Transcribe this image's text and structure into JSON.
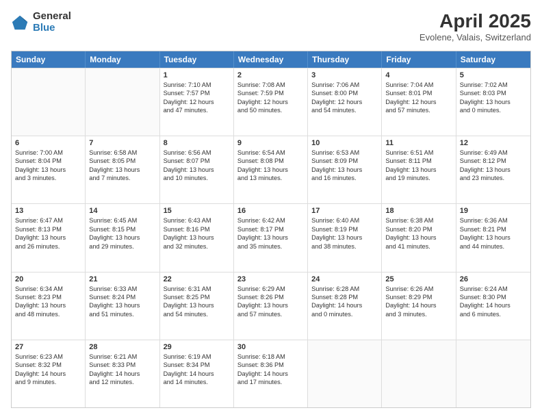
{
  "header": {
    "logo_general": "General",
    "logo_blue": "Blue",
    "month_title": "April 2025",
    "location": "Evolene, Valais, Switzerland"
  },
  "calendar": {
    "days_of_week": [
      "Sunday",
      "Monday",
      "Tuesday",
      "Wednesday",
      "Thursday",
      "Friday",
      "Saturday"
    ],
    "rows": [
      [
        {
          "day": "",
          "lines": []
        },
        {
          "day": "",
          "lines": []
        },
        {
          "day": "1",
          "lines": [
            "Sunrise: 7:10 AM",
            "Sunset: 7:57 PM",
            "Daylight: 12 hours",
            "and 47 minutes."
          ]
        },
        {
          "day": "2",
          "lines": [
            "Sunrise: 7:08 AM",
            "Sunset: 7:59 PM",
            "Daylight: 12 hours",
            "and 50 minutes."
          ]
        },
        {
          "day": "3",
          "lines": [
            "Sunrise: 7:06 AM",
            "Sunset: 8:00 PM",
            "Daylight: 12 hours",
            "and 54 minutes."
          ]
        },
        {
          "day": "4",
          "lines": [
            "Sunrise: 7:04 AM",
            "Sunset: 8:01 PM",
            "Daylight: 12 hours",
            "and 57 minutes."
          ]
        },
        {
          "day": "5",
          "lines": [
            "Sunrise: 7:02 AM",
            "Sunset: 8:03 PM",
            "Daylight: 13 hours",
            "and 0 minutes."
          ]
        }
      ],
      [
        {
          "day": "6",
          "lines": [
            "Sunrise: 7:00 AM",
            "Sunset: 8:04 PM",
            "Daylight: 13 hours",
            "and 3 minutes."
          ]
        },
        {
          "day": "7",
          "lines": [
            "Sunrise: 6:58 AM",
            "Sunset: 8:05 PM",
            "Daylight: 13 hours",
            "and 7 minutes."
          ]
        },
        {
          "day": "8",
          "lines": [
            "Sunrise: 6:56 AM",
            "Sunset: 8:07 PM",
            "Daylight: 13 hours",
            "and 10 minutes."
          ]
        },
        {
          "day": "9",
          "lines": [
            "Sunrise: 6:54 AM",
            "Sunset: 8:08 PM",
            "Daylight: 13 hours",
            "and 13 minutes."
          ]
        },
        {
          "day": "10",
          "lines": [
            "Sunrise: 6:53 AM",
            "Sunset: 8:09 PM",
            "Daylight: 13 hours",
            "and 16 minutes."
          ]
        },
        {
          "day": "11",
          "lines": [
            "Sunrise: 6:51 AM",
            "Sunset: 8:11 PM",
            "Daylight: 13 hours",
            "and 19 minutes."
          ]
        },
        {
          "day": "12",
          "lines": [
            "Sunrise: 6:49 AM",
            "Sunset: 8:12 PM",
            "Daylight: 13 hours",
            "and 23 minutes."
          ]
        }
      ],
      [
        {
          "day": "13",
          "lines": [
            "Sunrise: 6:47 AM",
            "Sunset: 8:13 PM",
            "Daylight: 13 hours",
            "and 26 minutes."
          ]
        },
        {
          "day": "14",
          "lines": [
            "Sunrise: 6:45 AM",
            "Sunset: 8:15 PM",
            "Daylight: 13 hours",
            "and 29 minutes."
          ]
        },
        {
          "day": "15",
          "lines": [
            "Sunrise: 6:43 AM",
            "Sunset: 8:16 PM",
            "Daylight: 13 hours",
            "and 32 minutes."
          ]
        },
        {
          "day": "16",
          "lines": [
            "Sunrise: 6:42 AM",
            "Sunset: 8:17 PM",
            "Daylight: 13 hours",
            "and 35 minutes."
          ]
        },
        {
          "day": "17",
          "lines": [
            "Sunrise: 6:40 AM",
            "Sunset: 8:19 PM",
            "Daylight: 13 hours",
            "and 38 minutes."
          ]
        },
        {
          "day": "18",
          "lines": [
            "Sunrise: 6:38 AM",
            "Sunset: 8:20 PM",
            "Daylight: 13 hours",
            "and 41 minutes."
          ]
        },
        {
          "day": "19",
          "lines": [
            "Sunrise: 6:36 AM",
            "Sunset: 8:21 PM",
            "Daylight: 13 hours",
            "and 44 minutes."
          ]
        }
      ],
      [
        {
          "day": "20",
          "lines": [
            "Sunrise: 6:34 AM",
            "Sunset: 8:23 PM",
            "Daylight: 13 hours",
            "and 48 minutes."
          ]
        },
        {
          "day": "21",
          "lines": [
            "Sunrise: 6:33 AM",
            "Sunset: 8:24 PM",
            "Daylight: 13 hours",
            "and 51 minutes."
          ]
        },
        {
          "day": "22",
          "lines": [
            "Sunrise: 6:31 AM",
            "Sunset: 8:25 PM",
            "Daylight: 13 hours",
            "and 54 minutes."
          ]
        },
        {
          "day": "23",
          "lines": [
            "Sunrise: 6:29 AM",
            "Sunset: 8:26 PM",
            "Daylight: 13 hours",
            "and 57 minutes."
          ]
        },
        {
          "day": "24",
          "lines": [
            "Sunrise: 6:28 AM",
            "Sunset: 8:28 PM",
            "Daylight: 14 hours",
            "and 0 minutes."
          ]
        },
        {
          "day": "25",
          "lines": [
            "Sunrise: 6:26 AM",
            "Sunset: 8:29 PM",
            "Daylight: 14 hours",
            "and 3 minutes."
          ]
        },
        {
          "day": "26",
          "lines": [
            "Sunrise: 6:24 AM",
            "Sunset: 8:30 PM",
            "Daylight: 14 hours",
            "and 6 minutes."
          ]
        }
      ],
      [
        {
          "day": "27",
          "lines": [
            "Sunrise: 6:23 AM",
            "Sunset: 8:32 PM",
            "Daylight: 14 hours",
            "and 9 minutes."
          ]
        },
        {
          "day": "28",
          "lines": [
            "Sunrise: 6:21 AM",
            "Sunset: 8:33 PM",
            "Daylight: 14 hours",
            "and 12 minutes."
          ]
        },
        {
          "day": "29",
          "lines": [
            "Sunrise: 6:19 AM",
            "Sunset: 8:34 PM",
            "Daylight: 14 hours",
            "and 14 minutes."
          ]
        },
        {
          "day": "30",
          "lines": [
            "Sunrise: 6:18 AM",
            "Sunset: 8:36 PM",
            "Daylight: 14 hours",
            "and 17 minutes."
          ]
        },
        {
          "day": "",
          "lines": []
        },
        {
          "day": "",
          "lines": []
        },
        {
          "day": "",
          "lines": []
        }
      ]
    ]
  }
}
